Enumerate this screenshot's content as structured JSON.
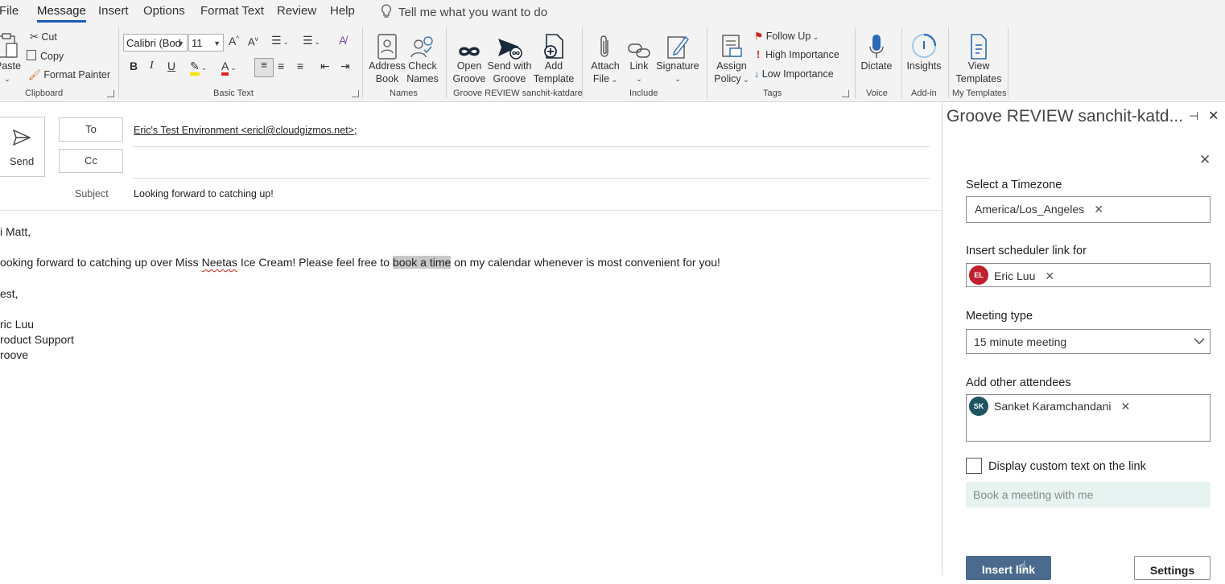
{
  "tabs": [
    "File",
    "Message",
    "Insert",
    "Options",
    "Format Text",
    "Review",
    "Help"
  ],
  "tell_me": "Tell me what you want to do",
  "ribbon": {
    "clipboard": {
      "paste": "Paste",
      "cut": "Cut",
      "copy": "Copy",
      "format_painter": "Format Painter",
      "label": "Clipboard"
    },
    "basic_text": {
      "font": "Calibri (Bod",
      "size": "11",
      "label": "Basic Text",
      "bold": "B",
      "italic": "I",
      "underline": "U"
    },
    "names": {
      "address_book_1": "Address",
      "address_book_2": "Book",
      "check_names_1": "Check",
      "check_names_2": "Names",
      "label": "Names"
    },
    "groove": {
      "open_1": "Open",
      "open_2": "Groove",
      "send_1": "Send with",
      "send_2": "Groove",
      "add_1": "Add",
      "add_2": "Template",
      "label": "Groove REVIEW sanchit-katdare"
    },
    "include": {
      "attach_1": "Attach",
      "attach_2": "File",
      "link": "Link",
      "signature": "Signature",
      "label": "Include"
    },
    "tags": {
      "assign_1": "Assign",
      "assign_2": "Policy",
      "follow_up": "Follow Up",
      "high": "High Importance",
      "low": "Low Importance",
      "label": "Tags"
    },
    "voice": {
      "dictate": "Dictate",
      "label": "Voice"
    },
    "addin": {
      "insights": "Insights",
      "label": "Add-in"
    },
    "templates": {
      "view_1": "View",
      "view_2": "Templates",
      "label": "My Templates"
    }
  },
  "compose": {
    "send": "Send",
    "to_label": "To",
    "cc_label": "Cc",
    "subject_label": "Subject",
    "to_value": "Eric's Test Environment <ericl@cloudgizmos.net>;",
    "subject_value": "Looking forward to catching up!",
    "body": {
      "greeting": "i Matt,",
      "line1_pre": "ooking forward to catching up over Miss ",
      "line1_misspelled": "Neetas",
      "line1_mid": " Ice Cream! Please feel free to ",
      "line1_link": "book a time",
      "line1_post": " on my calendar whenever is most convenient for you!",
      "closing": "est,",
      "sig1": "ric Luu",
      "sig2": "roduct Support",
      "sig3": "roove"
    }
  },
  "pane": {
    "title": "Groove REVIEW sanchit-katd...",
    "timezone_label": "Select a Timezone",
    "timezone_value": "America/Los_Angeles",
    "scheduler_label": "Insert scheduler link for",
    "scheduler_initials": "EL",
    "scheduler_value": "Eric Luu",
    "meeting_type_label": "Meeting type",
    "meeting_type_value": "15 minute meeting",
    "attendees_label": "Add other attendees",
    "attendee_initials": "SK",
    "attendee_value": "Sanket Karamchandani",
    "custom_text_label": "Display custom text on the link",
    "custom_text_placeholder": "Book a meeting with me",
    "insert_button": "Insert link",
    "settings_button": "Settings"
  },
  "colors": {
    "accent": "#185abd",
    "avatar_el": "#c0202e",
    "avatar_sk": "#1f5561",
    "primary_button": "#4a6a8e",
    "placeholder_bg": "#e6f3f1"
  }
}
